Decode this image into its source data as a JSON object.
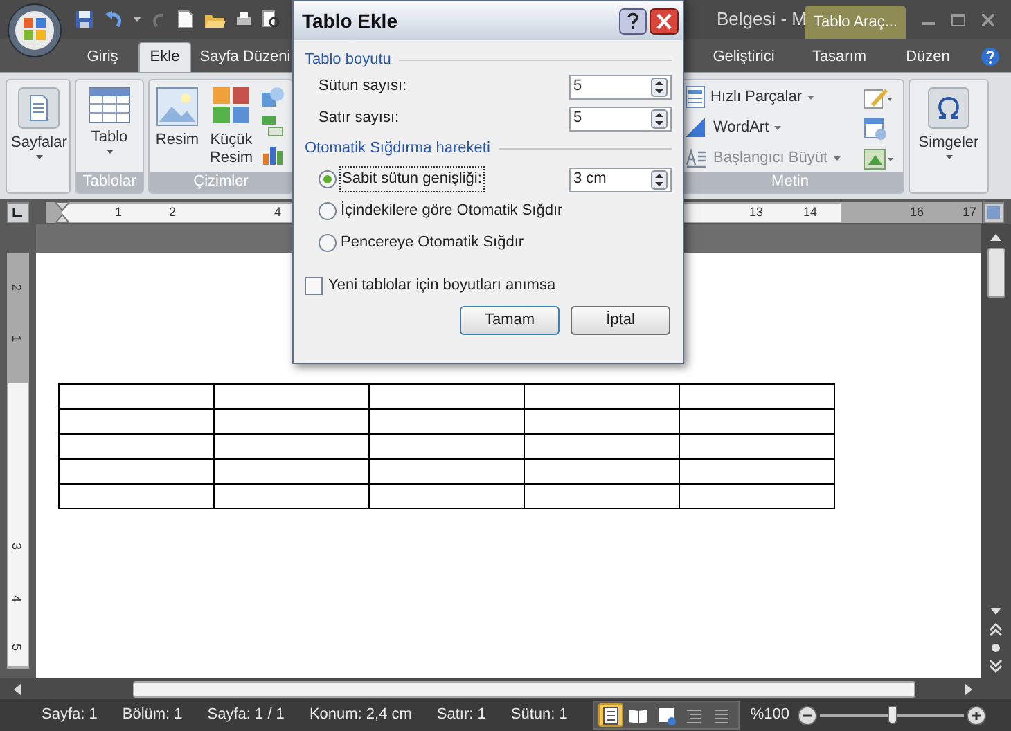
{
  "title_bar": {
    "title": "Belgesi - M",
    "context_tab": "Tablo Araç..."
  },
  "ribbon_tabs": [
    {
      "label": "Giriş",
      "selected": false
    },
    {
      "label": "Ekle",
      "selected": true
    },
    {
      "label": "Sayfa Düzeni",
      "selected": false
    },
    {
      "label": "Geliştirici",
      "selected": false
    },
    {
      "label": "Tasarım",
      "selected": false
    },
    {
      "label": "Düzen",
      "selected": false
    }
  ],
  "ribbon": {
    "pages_button": "Sayfalar",
    "groups": [
      {
        "label": "Tablolar",
        "buttons": [
          "Tablo"
        ]
      },
      {
        "label": "Çizimler",
        "buttons": [
          "Resim",
          "Küçük Resim"
        ]
      }
    ],
    "text_group": {
      "label": "Metin",
      "items": [
        "Hızlı Parçalar",
        "WordArt",
        "Başlangıcı Büyüt"
      ]
    },
    "symbols_button": "Simgeler"
  },
  "horizontal_ruler": [
    "1",
    "2",
    "4",
    "13",
    "14",
    "16",
    "17"
  ],
  "vertical_ruler": [
    "2",
    "1",
    "3",
    "4",
    "5"
  ],
  "dialog": {
    "title": "Tablo Ekle",
    "size_section": "Tablo boyutu",
    "fields": [
      {
        "label": "Sütun sayısı:",
        "value": "5"
      },
      {
        "label": "Satır sayısı:",
        "value": "5"
      }
    ],
    "autofit_section": "Otomatik Sığdırma hareketi",
    "options": [
      {
        "label": "Sabit sütun genişliği:",
        "selected": true,
        "value": "3 cm"
      },
      {
        "label": "İçindekilere göre Otomatik Sığdır",
        "selected": false
      },
      {
        "label": "Pencereye Otomatik Sığdır",
        "selected": false
      }
    ],
    "remember": {
      "label": "Yeni tablolar için boyutları anımsa",
      "checked": false
    },
    "buttons": [
      "Tamam",
      "İptal"
    ]
  },
  "status_bar": {
    "items": [
      "Sayfa: 1",
      "Bölüm: 1",
      "Sayfa: 1 / 1",
      "Konum: 2,4 cm",
      "Satır: 1",
      "Sütun: 1"
    ],
    "views": [
      {
        "selected": true
      },
      {
        "selected": false
      },
      {
        "selected": false
      },
      {
        "selected": false
      },
      {
        "selected": false
      }
    ],
    "zoom": "%100",
    "zoom_slider": {
      "level": 0.5
    }
  }
}
